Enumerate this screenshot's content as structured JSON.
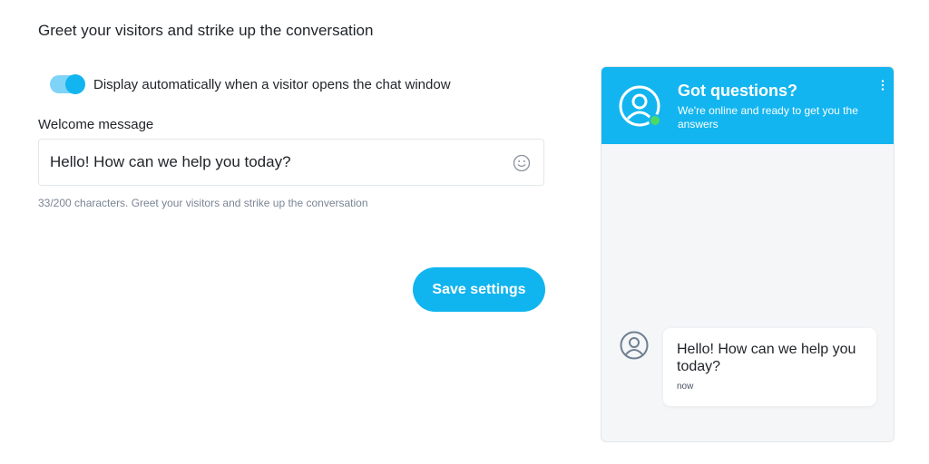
{
  "section": {
    "title": "Greet your visitors and strike up the conversation"
  },
  "toggle": {
    "label": "Display automatically when a visitor opens the chat window",
    "checked": true
  },
  "welcome": {
    "label": "Welcome message",
    "value": "Hello! How can we help you today?",
    "help": "33/200 characters. Greet your visitors and strike up the conversation",
    "emoji_icon": "smiley-icon"
  },
  "save_button": {
    "label": "Save settings"
  },
  "chat": {
    "header_title": "Got questions?",
    "header_subtitle": "We're online and ready to get you the answers",
    "menu_icon": "kebab-menu-icon",
    "avatar_icon": "user-circle-icon",
    "message_text": "Hello! How can we help you today?",
    "message_time": "now"
  },
  "colors": {
    "accent": "#12b5ef",
    "toggle_track": "#7fd3f7",
    "online": "#4cd964",
    "chat_bg": "#f4f6f8"
  }
}
